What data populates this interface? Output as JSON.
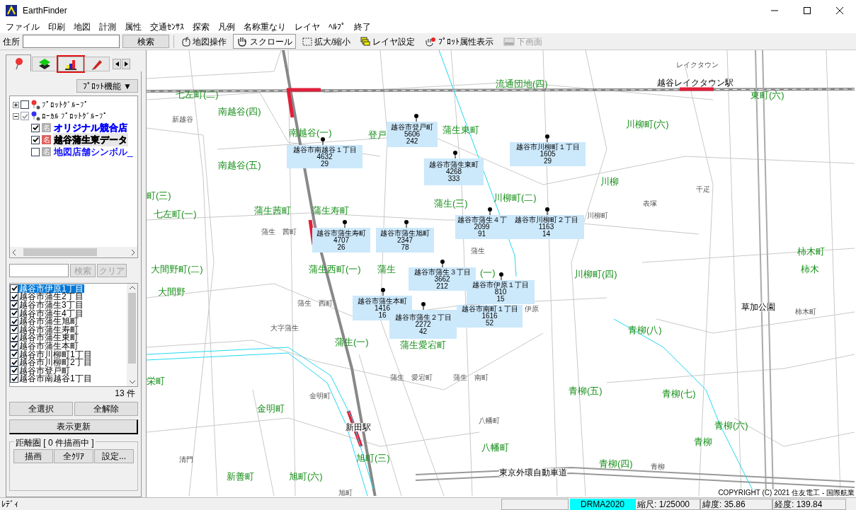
{
  "window": {
    "title": "EarthFinder"
  },
  "menu": [
    "ファイル",
    "印刷",
    "地図",
    "計測",
    "属性",
    "交通ｾﾝｻｽ",
    "探索",
    "凡例",
    "名称重なり",
    "レイヤ",
    "ﾍﾙﾌﾟ",
    "終了"
  ],
  "toolbar": {
    "address_label": "住所",
    "search_button": "検索",
    "tools": [
      {
        "label": "地図操作",
        "kind": "mouse",
        "pressed": false,
        "disabled": false
      },
      {
        "label": "スクロール",
        "kind": "hand",
        "pressed": true,
        "disabled": false
      },
      {
        "label": "拡大/縮小",
        "kind": "zoom",
        "pressed": false,
        "disabled": false
      },
      {
        "label": "レイヤ設定",
        "kind": "layers",
        "pressed": false,
        "disabled": false
      },
      {
        "label": "ﾌﾟﾛｯﾄ属性表示",
        "kind": "plot",
        "pressed": false,
        "disabled": false
      },
      {
        "label": "下画面",
        "kind": "screen",
        "pressed": false,
        "disabled": true
      }
    ]
  },
  "side_tabs": [
    {
      "kind": "pin",
      "selected": true,
      "highlighted": false
    },
    {
      "kind": "layers",
      "selected": false,
      "highlighted": false
    },
    {
      "kind": "chart",
      "selected": false,
      "highlighted": true
    },
    {
      "kind": "pen",
      "selected": false,
      "highlighted": false
    }
  ],
  "plot_menu_button": "ﾌﾟﾛｯﾄ機能 ▼",
  "plot_tree": [
    {
      "label": "ﾌﾟﾛｯﾄｸﾞﾙｰﾌﾟ",
      "checked": false,
      "partial": false,
      "expanded": false
    },
    {
      "label": "ﾛｰｶﾙ ﾌﾟﾛｯﾄｸﾞﾙｰﾌﾟ",
      "checked": true,
      "partial": true,
      "expanded": true,
      "children": [
        {
          "label": "オリジナル競合店",
          "tag": "名",
          "checked": true,
          "selected": false,
          "color": "#0000ff"
        },
        {
          "label": "越谷蒲生東データ",
          "tag": "名",
          "checked": true,
          "selected": true,
          "color": "#000000"
        },
        {
          "label": "地図店舗シンボル_",
          "tag": "名",
          "checked": false,
          "selected": false,
          "color": "#0000ff"
        }
      ]
    }
  ],
  "list_search": {
    "search_button": "検索",
    "clear_button": "クリア",
    "disabled": true
  },
  "list_items": [
    {
      "label": "越谷市伊原1丁目",
      "checked": true,
      "selected": true
    },
    {
      "label": "越谷市蒲生2丁目",
      "checked": true,
      "selected": false
    },
    {
      "label": "越谷市蒲生3丁目",
      "checked": true,
      "selected": false
    },
    {
      "label": "越谷市蒲生4丁目",
      "checked": true,
      "selected": false
    },
    {
      "label": "越谷市蒲生旭町",
      "checked": true,
      "selected": false
    },
    {
      "label": "越谷市蒲生寿町",
      "checked": true,
      "selected": false
    },
    {
      "label": "越谷市蒲生東町",
      "checked": true,
      "selected": false
    },
    {
      "label": "越谷市蒲生本町",
      "checked": true,
      "selected": false
    },
    {
      "label": "越谷市川柳町1丁目",
      "checked": true,
      "selected": false
    },
    {
      "label": "越谷市川柳町2丁目",
      "checked": true,
      "selected": false
    },
    {
      "label": "越谷市登戸町",
      "checked": true,
      "selected": false
    },
    {
      "label": "越谷市南越谷1丁目",
      "checked": true,
      "selected": false
    }
  ],
  "list_count": "13 件",
  "select_all_button": "全選択",
  "clear_all_button": "全解除",
  "refresh_button": "表示更新",
  "distance_group": {
    "title": "距離圏 [ 0 件描画中 ]",
    "buttons": [
      "描画",
      "全ｸﾘｱ",
      "設定..."
    ]
  },
  "map": {
    "labels": [
      {
        "text": "七左町(二)",
        "kind": "area"
      },
      {
        "text": "南越谷(四)",
        "kind": "area"
      },
      {
        "text": "南越谷(一)",
        "kind": "area"
      },
      {
        "text": "登戸",
        "kind": "area"
      },
      {
        "text": "蒲生東町",
        "kind": "area"
      },
      {
        "text": "南越谷(五)",
        "kind": "area"
      },
      {
        "text": "流通団地(四)",
        "kind": "area"
      },
      {
        "text": "東町(六)",
        "kind": "area"
      },
      {
        "text": "川柳町(六)",
        "kind": "area"
      },
      {
        "text": "川柳",
        "kind": "area"
      },
      {
        "text": "川柳町(二)",
        "kind": "area"
      },
      {
        "text": "蒲生(三)",
        "kind": "area"
      },
      {
        "text": "町(三)",
        "kind": "area"
      },
      {
        "text": "七左町(一)",
        "kind": "area"
      },
      {
        "text": "蒲生茜町",
        "kind": "area"
      },
      {
        "text": "蒲生寿町",
        "kind": "area"
      },
      {
        "text": "柿木町",
        "kind": "area"
      },
      {
        "text": "大間野町(二)",
        "kind": "area"
      },
      {
        "text": "蒲生西町(一)",
        "kind": "area"
      },
      {
        "text": "蒲生",
        "kind": "area"
      },
      {
        "text": "(一)",
        "kind": "area"
      },
      {
        "text": "川柳町(四)",
        "kind": "area"
      },
      {
        "text": "大間野",
        "kind": "area"
      },
      {
        "text": "柿木",
        "kind": "area"
      },
      {
        "text": "草加公園",
        "kind": "landmark"
      },
      {
        "text": "青柳(八)",
        "kind": "area"
      },
      {
        "text": "蒲生(一)",
        "kind": "area"
      },
      {
        "text": "蒲生愛宕町",
        "kind": "area"
      },
      {
        "text": "栄町",
        "kind": "area"
      },
      {
        "text": "青柳(五)",
        "kind": "area"
      },
      {
        "text": "青柳(七)",
        "kind": "area"
      },
      {
        "text": "金明町",
        "kind": "area"
      },
      {
        "text": "青柳(六)",
        "kind": "area"
      },
      {
        "text": "青柳",
        "kind": "area"
      },
      {
        "text": "新田駅",
        "kind": "landmark"
      },
      {
        "text": "八幡町",
        "kind": "area"
      },
      {
        "text": "旭町(三)",
        "kind": "area"
      },
      {
        "text": "青柳(四)",
        "kind": "area"
      },
      {
        "text": "新善町",
        "kind": "area"
      },
      {
        "text": "旭町(六)",
        "kind": "area"
      },
      {
        "text": "東京外環自動車道",
        "kind": "landmark"
      },
      {
        "text": "レイクタウン",
        "kind": "place"
      },
      {
        "text": "越谷レイクタウン駅",
        "kind": "landmark"
      },
      {
        "text": "新越谷",
        "kind": "place"
      },
      {
        "text": "千疋",
        "kind": "place"
      },
      {
        "text": "表塚",
        "kind": "place"
      },
      {
        "text": "川柳町",
        "kind": "place"
      },
      {
        "text": "蒲生　茜町",
        "kind": "place"
      },
      {
        "text": "蒲生",
        "kind": "place"
      },
      {
        "text": "蒲生　西町",
        "kind": "place"
      },
      {
        "text": "伊原",
        "kind": "place"
      },
      {
        "text": "柿木町",
        "kind": "place"
      },
      {
        "text": "大字蒲生",
        "kind": "place"
      },
      {
        "text": "蒲生　愛宕町",
        "kind": "place"
      },
      {
        "text": "蒲生　南町",
        "kind": "place"
      },
      {
        "text": "金明町",
        "kind": "place"
      },
      {
        "text": "八幡町",
        "kind": "place"
      },
      {
        "text": "清門",
        "kind": "place"
      },
      {
        "text": "青柳",
        "kind": "place"
      },
      {
        "text": "旭町",
        "kind": "place"
      }
    ],
    "data_boxes": [
      {
        "title": "越谷市南越谷１丁目",
        "value_1": "4632",
        "value_2": "29"
      },
      {
        "title": "越谷市登戸町",
        "value_1": "5606",
        "value_2": "242"
      },
      {
        "title": "越谷市蒲生東町",
        "value_1": "4268",
        "value_2": "333"
      },
      {
        "title": "越谷市川柳町１丁目",
        "value_1": "1605",
        "value_2": "29"
      },
      {
        "title": "越谷市蒲生寿町",
        "value_1": "4707",
        "value_2": "26"
      },
      {
        "title": "越谷市蒲生旭町",
        "value_1": "2347",
        "value_2": "78"
      },
      {
        "title": "越谷市蒲生４丁",
        "value_1": "2099",
        "value_2": "91"
      },
      {
        "title": "越谷市川柳町２丁目",
        "value_1": "1163",
        "value_2": "14"
      },
      {
        "title": "越谷市蒲生３丁目",
        "value_1": "3662",
        "value_2": "212"
      },
      {
        "title": "越谷市伊原１丁目",
        "value_1": "810",
        "value_2": "15"
      },
      {
        "title": "越谷市蒲生本町",
        "value_1": "1416",
        "value_2": "16"
      },
      {
        "title": "越谷市南町１丁目",
        "value_1": "1616",
        "value_2": "52"
      },
      {
        "title": "越谷市蒲生２丁目",
        "value_1": "2272",
        "value_2": "42"
      }
    ],
    "copyright": "COPYRIGHT (C) 2021 住友電工 - 国際航業"
  },
  "status_bar": {
    "message": "ﾚﾃﾞｨ",
    "dataset": "DRMA2020",
    "scale": "縮尺: 1/25000",
    "latitude": "緯度: 35.86",
    "longitude": "経度: 139.84"
  }
}
